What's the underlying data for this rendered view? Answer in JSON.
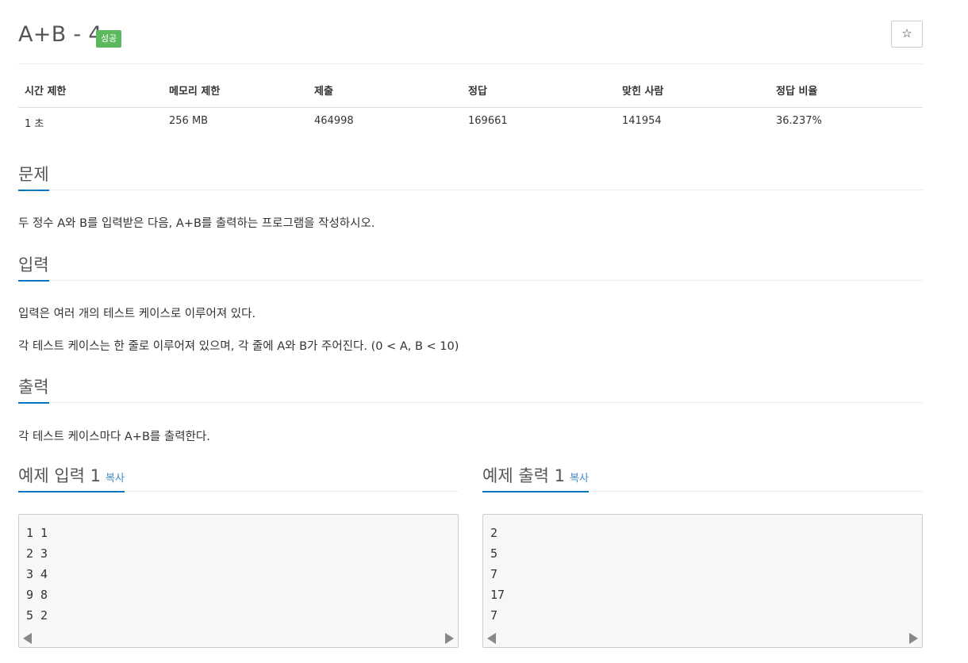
{
  "problem": {
    "title": "A+B - 4",
    "status_badge": "성공",
    "star_icon": "☆"
  },
  "stats": {
    "headers": [
      "시간 제한",
      "메모리 제한",
      "제출",
      "정답",
      "맞힌 사람",
      "정답 비율"
    ],
    "values": [
      "1 초",
      "256 MB",
      "464998",
      "169661",
      "141954",
      "36.237%"
    ]
  },
  "sections": {
    "description": {
      "heading": "문제",
      "paragraphs": [
        "두 정수 A와 B를 입력받은 다음, A+B를 출력하는 프로그램을 작성하시오."
      ]
    },
    "input": {
      "heading": "입력",
      "paragraphs": [
        "입력은 여러 개의 테스트 케이스로 이루어져 있다.",
        "각 테스트 케이스는 한 줄로 이루어져 있으며, 각 줄에 A와 B가 주어진다. (0 < A, B < 10)"
      ]
    },
    "output": {
      "heading": "출력",
      "paragraphs": [
        "각 테스트 케이스마다 A+B를 출력한다."
      ]
    }
  },
  "samples": {
    "input": {
      "heading": "예제 입력 1",
      "copy_label": "복사",
      "lines": [
        "1 1",
        "2 3",
        "3 4",
        "9 8",
        "5 2"
      ]
    },
    "output": {
      "heading": "예제 출력 1",
      "copy_label": "복사",
      "lines": [
        "2",
        "5",
        "7",
        "17",
        "7"
      ]
    }
  },
  "colors": {
    "badge": "#5cb85c",
    "heading_underline": "#0076c0",
    "link": "#428bca",
    "sample_bg": "#f7f7f9"
  }
}
